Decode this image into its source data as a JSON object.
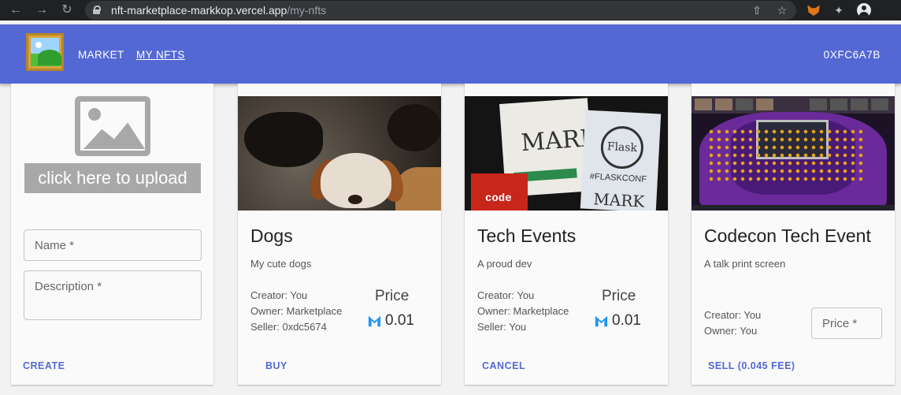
{
  "browser": {
    "url_host": "nft-marketplace-markkop.vercel.app",
    "url_path": "/my-nfts",
    "nav_icons": [
      "back-arrow-icon",
      "forward-arrow-icon",
      "reload-icon"
    ],
    "extension_icons": [
      "share-icon",
      "star-icon",
      "metamask-fox-icon",
      "puzzle-icon",
      "profile-icon"
    ]
  },
  "header": {
    "nav": [
      {
        "label": "MARKET"
      },
      {
        "label": "MY NFTS"
      }
    ],
    "account": "0XFC6A7B",
    "colors": {
      "appbar": "#5468d4",
      "accent": "#5468d4"
    }
  },
  "upload": {
    "button_label": "click here to upload",
    "name_placeholder": "Name *",
    "description_placeholder": "Description *",
    "action_label": "CREATE"
  },
  "cards": [
    {
      "title": "Dogs",
      "description": "My cute dogs",
      "meta": [
        "Creator: You",
        "Owner: Marketplace",
        "Seller: 0xdc5674"
      ],
      "price_label": "Price",
      "price": "0.01",
      "action_label": "BUY"
    },
    {
      "title": "Tech Events",
      "description": "A proud dev",
      "meta": [
        "Creator: You",
        "Owner: Marketplace",
        "Seller: You"
      ],
      "price_label": "Price",
      "price": "0.01",
      "action_label": "CANCEL",
      "image_text": {
        "badge1": "MARK",
        "badge2_logo": "Flask",
        "badge2_hashtag": "#FLASKCONF",
        "badge2_name": "MARK",
        "tag": "code"
      }
    },
    {
      "title": "Codecon Tech Event",
      "description": "A talk print screen",
      "meta": [
        "Creator: You",
        "Owner: You"
      ],
      "price_placeholder": "Price *",
      "action_label": "SELL (0.045 FEE)"
    }
  ]
}
